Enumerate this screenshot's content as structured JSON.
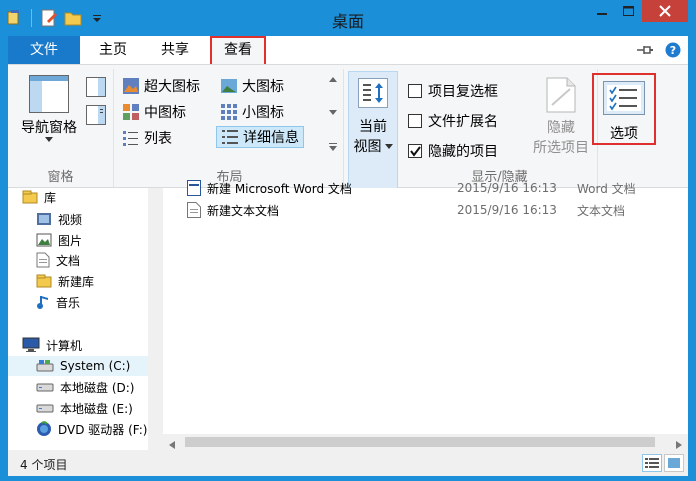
{
  "window": {
    "title": "桌面"
  },
  "tabs": [
    {
      "label": "文件"
    },
    {
      "label": "主页"
    },
    {
      "label": "共享"
    },
    {
      "label": "查看"
    }
  ],
  "ribbon": {
    "panes": {
      "label": "窗格",
      "nav_pane": "导航窗格"
    },
    "layout": {
      "label": "布局",
      "items": [
        "超大图标",
        "大图标",
        "中图标",
        "小图标",
        "列表",
        "详细信息"
      ]
    },
    "current_view": {
      "line1": "当前",
      "line2": "视图"
    },
    "showhide": {
      "label": "显示/隐藏",
      "checkboxes": [
        {
          "label": "项目复选框",
          "checked": false
        },
        {
          "label": "文件扩展名",
          "checked": false
        },
        {
          "label": "隐藏的项目",
          "checked": true
        }
      ],
      "hide_selected_line1": "隐藏",
      "hide_selected_line2": "所选项目"
    },
    "options": {
      "label": "选项"
    }
  },
  "nav": {
    "items": [
      {
        "label": "库",
        "icon": "library-icon"
      },
      {
        "label": "视频",
        "icon": "video-icon"
      },
      {
        "label": "图片",
        "icon": "picture-icon"
      },
      {
        "label": "文档",
        "icon": "document-icon"
      },
      {
        "label": "新建库",
        "icon": "library-icon"
      },
      {
        "label": "音乐",
        "icon": "music-icon"
      },
      {
        "label": "计算机",
        "icon": "computer-icon"
      },
      {
        "label": "System (C:)",
        "icon": "system-drive-icon"
      },
      {
        "label": "本地磁盘 (D:)",
        "icon": "drive-icon"
      },
      {
        "label": "本地磁盘 (E:)",
        "icon": "drive-icon"
      },
      {
        "label": "DVD 驱动器 (F:)",
        "icon": "dvd-drive-icon"
      }
    ]
  },
  "files": [
    {
      "name": "新建 Microsoft Word 文档",
      "date": "2015/9/16 16:13",
      "type": "Word 文档"
    },
    {
      "name": "新建文本文档",
      "date": "2015/9/16 16:13",
      "type": "文本文档"
    }
  ],
  "status": {
    "count": "4 个项目"
  },
  "colors": {
    "accent": "#1b8fd8",
    "file_tab": "#1979ca",
    "highlight": "#e0302e",
    "close": "#c7413b"
  }
}
